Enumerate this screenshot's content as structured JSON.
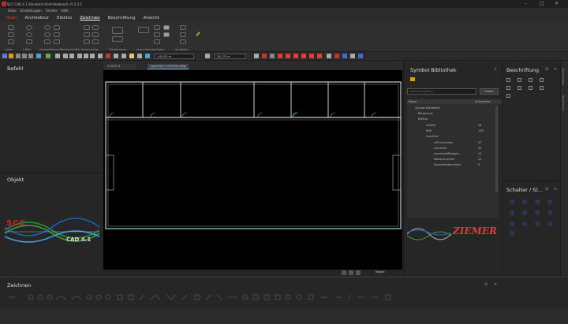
{
  "window": {
    "title": "SCC CAD 4.1 Standard (Vertriebsband) v5.5.3.1",
    "minimize": "–",
    "maximize": "□",
    "close": "✕"
  },
  "menu": [
    "Datei",
    "Einstellungen",
    "Fenster",
    "Hilfe"
  ],
  "ribbon_tabs": [
    "Start",
    "Architektur",
    "Elektro",
    "Zeichnen",
    "Beschriftung",
    "Ansicht"
  ],
  "ribbon_groups": [
    "Linien",
    "L-Bild",
    "Kreise/Ellipsen/Rechtecke/Elli...",
    "Konstruktion",
    "Transformati...",
    "Ausrichten/Verteilen",
    "Architekt..."
  ],
  "toolbar": {
    "coord_x": "-45,033 m",
    "coord_y": "26,274 m"
  },
  "panels": {
    "befehl": "Befehl",
    "objekt": "Objekt",
    "symbol_bibliothek": "Symbol Bibliothek",
    "beschriftung": "Beschriftung",
    "schalter": "Schalter / St...",
    "zeichnen": "Zeichnen",
    "close": "×",
    "pin": "ⵙ"
  },
  "doc_tabs": [
    "1.00.37 ▾ Extra.dwg",
    "Lagerhalle mit Büros.dwg"
  ],
  "doc_tab_close": "×",
  "canvas_bar": {
    "model": "Modell"
  },
  "symbol_search": {
    "placeholder": "Suchen begriffen...",
    "button": "Finden"
  },
  "symbol_table": {
    "headers": [
      "Name",
      "# Symbole"
    ],
    "rows": [
      {
        "name": "Symbol Bibliothek",
        "count": ""
      },
      {
        "name": "Blitzschutz",
        "count": ""
      },
      {
        "name": "Elektro",
        "count": ""
      },
      {
        "name": "Geräte",
        "count": "28"
      },
      {
        "name": "KNX",
        "count": "139"
      },
      {
        "name": "Leuchten",
        "count": ""
      },
      {
        "name": "LED-Leuchten",
        "count": "27"
      },
      {
        "name": "Leuchten",
        "count": "35"
      },
      {
        "name": "Leuchtstofflampen",
        "count": "10"
      },
      {
        "name": "Rasterleuchten",
        "count": "22"
      },
      {
        "name": "Sicherheitsleuchten",
        "count": "9"
      }
    ]
  },
  "logos": {
    "scc_text": "SCC",
    "cad_text": "CAD 4.1",
    "ziemer": "ZIEMER"
  },
  "side_strip": [
    "Eigenschaften",
    "Beschriftung"
  ],
  "colors": {
    "accent_red": "#e53935",
    "canvas": "#000000",
    "panel": "#262626"
  }
}
